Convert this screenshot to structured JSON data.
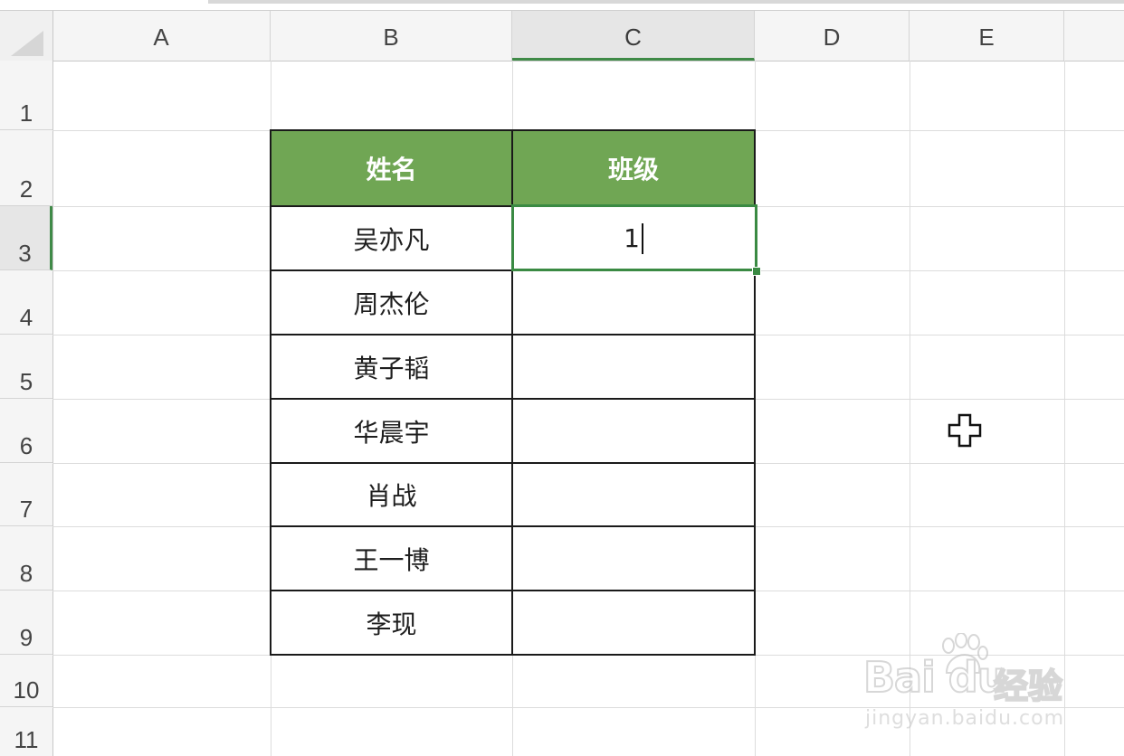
{
  "spreadsheet": {
    "columns": [
      "A",
      "B",
      "C",
      "D",
      "E"
    ],
    "rows": [
      "1",
      "2",
      "3",
      "4",
      "5",
      "6",
      "7",
      "8",
      "9",
      "10",
      "11"
    ],
    "active_column": "C",
    "active_row": "3"
  },
  "table": {
    "headers": [
      "姓名",
      "班级"
    ],
    "rows": [
      [
        "吴亦凡",
        "1"
      ],
      [
        "周杰伦",
        ""
      ],
      [
        "黄子韬",
        ""
      ],
      [
        "华晨宇",
        ""
      ],
      [
        "肖战",
        ""
      ],
      [
        "王一博",
        ""
      ],
      [
        "李现",
        ""
      ]
    ]
  },
  "editing_value": "1",
  "colors": {
    "header_fill": "#70a654",
    "selection_border": "#3a8a43",
    "grid_line": "#dcdcdc"
  },
  "icons": {
    "cursor": "crosshair-plus-icon",
    "select_all": "select-all-corner-icon"
  },
  "watermark": {
    "brand": "Bai du",
    "brand_cn": "经验",
    "url": "jingyan.baidu.com"
  }
}
